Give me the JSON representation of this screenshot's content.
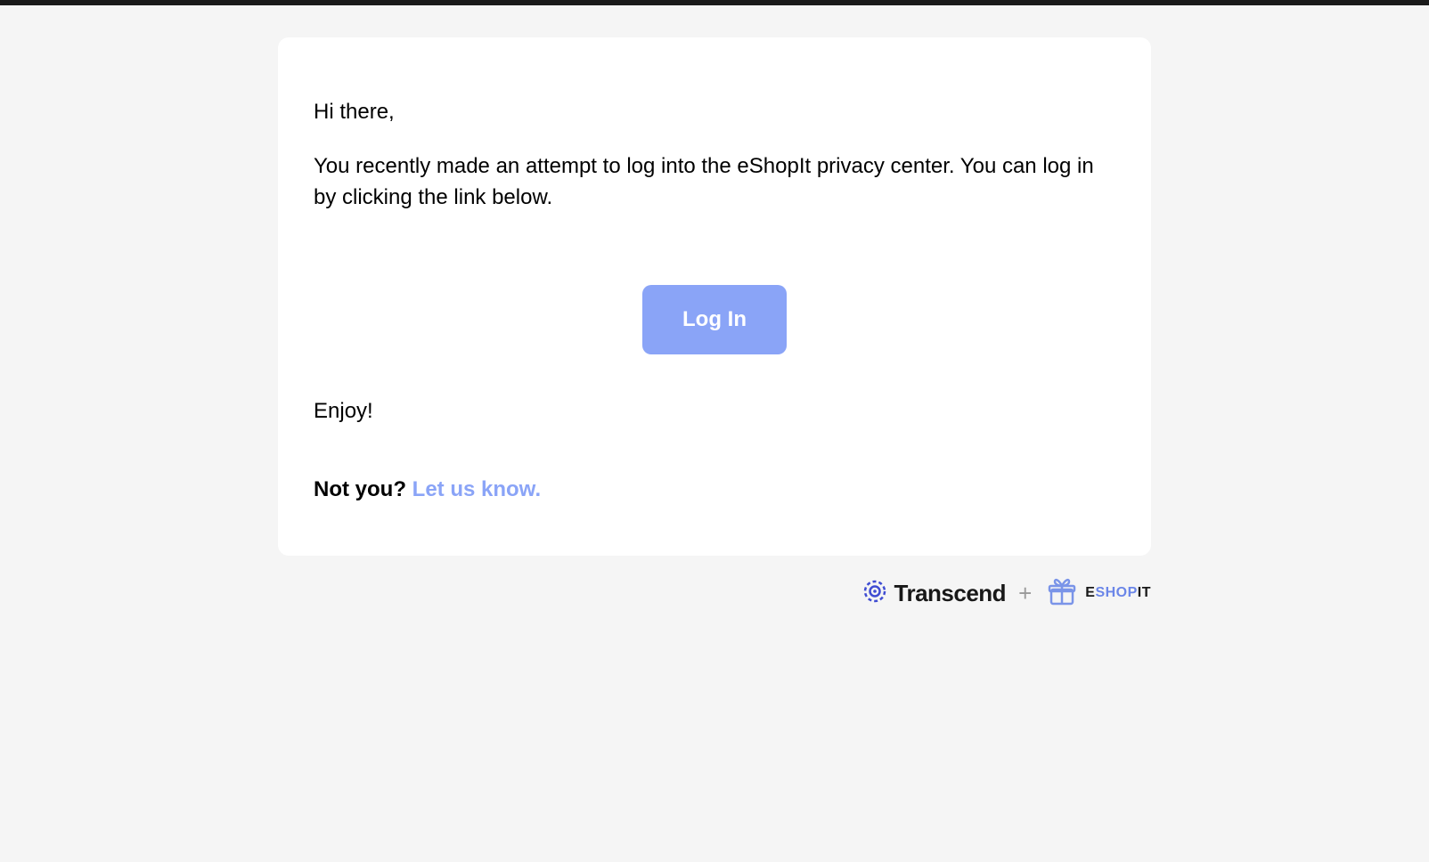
{
  "email": {
    "greeting": "Hi there,",
    "body": "You recently made an attempt to log into the eShopIt privacy center. You can log in by clicking the link below.",
    "cta_label": "Log In",
    "signoff": "Enjoy!",
    "not_you_prefix": "Not you? ",
    "not_you_link": "Let us know."
  },
  "footer": {
    "brand1": "Transcend",
    "plus": "+",
    "brand2_prefix": "E",
    "brand2_mid": "SHOP",
    "brand2_suffix": "IT"
  },
  "colors": {
    "accent": "#8aa4f7",
    "logo_blue": "#3f4cd2"
  }
}
